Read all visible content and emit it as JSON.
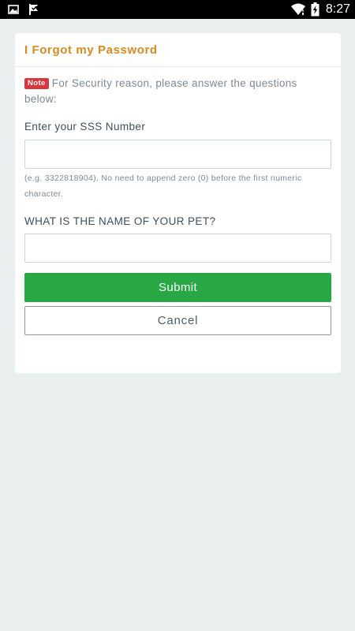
{
  "status_bar": {
    "time": "8:27",
    "icons_left": [
      "image-icon",
      "flag-check-icon"
    ],
    "icons_right": [
      "wifi-icon",
      "battery-charging-icon"
    ]
  },
  "form": {
    "title": "I Forgot my Password",
    "note_badge": "Note",
    "note_text": "For Security reason, please answer the questions below:",
    "sss_label": "Enter your SSS Number",
    "sss_value": "",
    "sss_hint": "(e.g. 3322818904). No need to append zero (0) before the first numeric character.",
    "pet_label": "WHAT IS THE NAME OF YOUR PET?",
    "pet_value": "",
    "submit_label": "Submit",
    "cancel_label": "Cancel"
  },
  "colors": {
    "title": "#d58b20",
    "badge": "#d9363e",
    "submit": "#28a745",
    "background": "#e9eeee"
  }
}
